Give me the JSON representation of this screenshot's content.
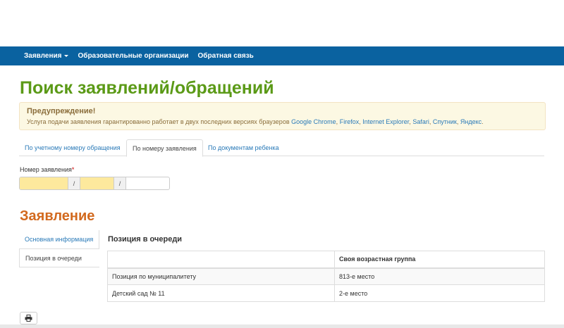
{
  "nav": {
    "items": [
      {
        "label": "Заявления",
        "has_caret": true
      },
      {
        "label": "Образовательные организации"
      },
      {
        "label": "Обратная связь"
      }
    ]
  },
  "page_title": "Поиск заявлений/обращений",
  "alert": {
    "title": "Предупреждение!",
    "text_prefix": "Услуга подачи заявления гарантированно работает в двух последних версиях браузеров",
    "browsers": [
      "Google Chrome",
      "Firefox",
      "Internet Explorer",
      "Safari",
      "Спутник",
      "Яндекс"
    ],
    "sep": ",",
    "end": "."
  },
  "tabs": [
    {
      "label": "По учетному номеру обращения",
      "active": false
    },
    {
      "label": "По номеру заявления",
      "active": true
    },
    {
      "label": "По документам ребенка",
      "active": false
    }
  ],
  "application_number": {
    "label": "Номер заявления",
    "required_mark": "*",
    "separator": "/"
  },
  "section_title": "Заявление",
  "side_nav": [
    {
      "label": "Основная информация",
      "active": false
    },
    {
      "label": "Позиция в очереди",
      "active": true
    }
  ],
  "queue": {
    "title": "Позиция в очереди",
    "header": [
      "",
      "Своя возрастная группа"
    ],
    "rows": [
      [
        "Позиция по муниципалитету",
        "813-е место"
      ],
      [
        "Детский сад № 11",
        "2-е место"
      ]
    ]
  },
  "colors": {
    "navbar": "#0a62a0",
    "title": "#5b9a17",
    "section": "#d2691e",
    "link": "#2a7ab8"
  }
}
